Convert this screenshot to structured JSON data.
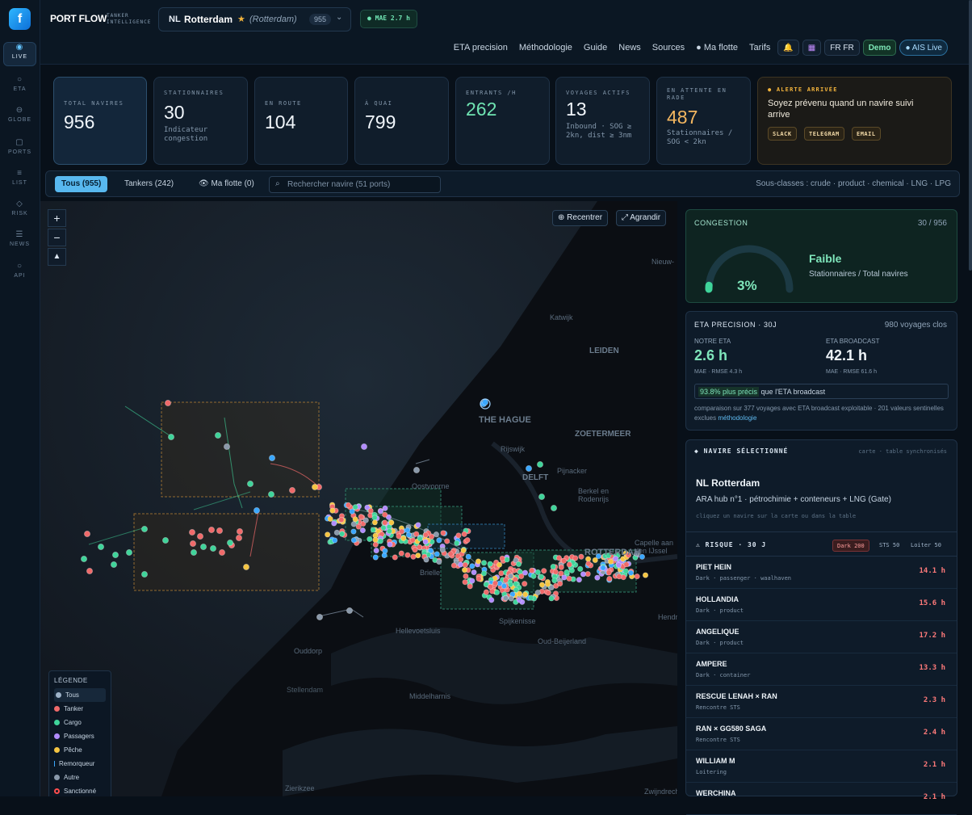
{
  "rail": {
    "logo": "f",
    "items": [
      {
        "label": "LIVE",
        "icon": "radar-icon"
      },
      {
        "label": "ETA",
        "icon": "clock-icon"
      },
      {
        "label": "GLOBE",
        "icon": "globe-icon"
      },
      {
        "label": "PORTS",
        "icon": "anchor-icon"
      },
      {
        "label": "LIST",
        "icon": "list-icon"
      },
      {
        "label": "RISK",
        "icon": "diamond-icon"
      },
      {
        "label": "NEWS",
        "icon": "news-icon"
      },
      {
        "label": "API",
        "icon": "api-icon"
      }
    ]
  },
  "header": {
    "brand": "PORT FLOW",
    "brand_sub_1": "TANKER",
    "brand_sub_2": "INTELLIGENCE",
    "port_flag": "NL",
    "port_name": "Rotterdam",
    "port_sub": "(Rotterdam)",
    "port_count": "955",
    "mae": "● MAE 2.7 h"
  },
  "nav": {
    "links": [
      "ETA precision",
      "Méthodologie",
      "Guide",
      "News",
      "Sources",
      "● Ma flotte",
      "Tarifs"
    ],
    "lang": "FR FR",
    "demo": "Demo",
    "live": "● AIS Live"
  },
  "stats": [
    {
      "label": "TOTAL NAVIRES",
      "value": "956",
      "sub": ""
    },
    {
      "label": "STATIONNAIRES",
      "value": "30",
      "sub": "Indicateur congestion"
    },
    {
      "label": "EN ROUTE",
      "value": "104",
      "sub": ""
    },
    {
      "label": "À QUAI",
      "value": "799",
      "sub": ""
    },
    {
      "label": "ENTRANTS /H",
      "value": "262",
      "sub": ""
    },
    {
      "label": "VOYAGES ACTIFS",
      "value": "13",
      "sub": "Inbound · SOG ≥ 2kn, dist ≥ 3nm"
    },
    {
      "label": "EN ATTENTE EN RADE",
      "value": "487",
      "sub": "Stationnaires / SOG < 2kn"
    }
  ],
  "alert": {
    "label": "● ALERTE ARRIVÉE",
    "text": "Soyez prévenu quand un navire suivi arrive",
    "channels": [
      "SLACK",
      "TELEGRAM",
      "EMAIL"
    ]
  },
  "filters": {
    "tab_all": "Tous (955)",
    "tab_tankers": "Tankers (242)",
    "tab_fleet": "👁 Ma flotte (0)",
    "search_placeholder": "Rechercher navire (51 ports)",
    "subclasses": "Sous-classes : crude · product · chemical · LNG · LPG"
  },
  "map": {
    "recenter": "⊕ Recentrer",
    "enlarge": "⤢ Agrandir",
    "places": [
      "Nieuw-",
      "Katwijk",
      "LEIDEN",
      "THE HAGUE",
      "ZOETERMEER",
      "Rijswijk",
      "DELFT",
      "Pijnacker",
      "Berkel en Rodenrijs",
      "Oostvoorne",
      "Brielle",
      "ROTTERDAM",
      "Capelle aan den IJssel",
      "Hellevoetsluis",
      "Spijkenisse",
      "Oud-Beijerland",
      "Ouddorp",
      "Middelharnis",
      "Stellendam",
      "Zierikzee",
      "Hendrik-",
      "Zwijndrecht"
    ],
    "legend_title": "LÉGENDE",
    "legend": [
      {
        "label": "Tous",
        "color": "#9fb3c8"
      },
      {
        "label": "Tanker",
        "color": "#f06a6a"
      },
      {
        "label": "Cargo",
        "color": "#3fd49a"
      },
      {
        "label": "Passagers",
        "color": "#b18cff"
      },
      {
        "label": "Pêche",
        "color": "#f5c542"
      },
      {
        "label": "Remorqueur",
        "color": "#3aa7ff"
      },
      {
        "label": "Autre",
        "color": "#8a99aa"
      },
      {
        "label": "Sanctionné",
        "color": "#ff4d4d"
      }
    ]
  },
  "congestion": {
    "label": "CONGESTION",
    "count": "30 / 956",
    "percent": "3%",
    "gauge_fraction": 0.03,
    "state": "Faible",
    "desc": "Stationnaires / Total navires"
  },
  "eta": {
    "label": "ETA PRECISION · 30J",
    "voyages": "980 voyages clos",
    "ours_label": "NOTRE ETA",
    "ours_value": "2.6 h",
    "ours_sub": "MAE · RMSE 4.3 h",
    "bc_label": "ETA BROADCAST",
    "bc_value": "42.1 h",
    "bc_sub": "MAE · RMSE 61.6 h",
    "cmp_hl": "93.8% plus précis",
    "cmp_rest": " que l'ETA broadcast",
    "note": "comparaison sur 377 voyages avec ETA broadcast exploitable · 201 valeurs sentinelles exclues ",
    "note_link": "méthodologie"
  },
  "vessel": {
    "head": "◆ NAVIRE SÉLECTIONNÉ",
    "sync": "carte · table synchronisés",
    "name": "NL Rotterdam",
    "desc": "ARA hub n°1 · pétrochimie + conteneurs + LNG (Gate)",
    "hint": "cliquez un navire sur la carte ou dans la table",
    "risk_label": "⚠ RISQUE · 30 J",
    "risk_tabs": [
      "Dark 200",
      "STS 50",
      "Loiter 50"
    ],
    "rows": [
      {
        "name": "PIET HEIN",
        "desc": "Dark · passenger · waalhaven",
        "time": "14.1 h"
      },
      {
        "name": "HOLLANDIA",
        "desc": "Dark · product",
        "time": "15.6 h"
      },
      {
        "name": "ANGELIQUE",
        "desc": "Dark · product",
        "time": "17.2 h"
      },
      {
        "name": "AMPERE",
        "desc": "Dark · container",
        "time": "13.3 h"
      },
      {
        "name": "RESCUE LENAH × RAN",
        "desc": "Rencontre STS",
        "time": "2.3 h"
      },
      {
        "name": "RAN × GG580 SAGA",
        "desc": "Rencontre STS",
        "time": "2.4 h"
      },
      {
        "name": "WILLIAM M",
        "desc": "Loitering",
        "time": "2.1 h"
      },
      {
        "name": "WERCHINA",
        "desc": "",
        "time": "2.1 h"
      }
    ]
  }
}
